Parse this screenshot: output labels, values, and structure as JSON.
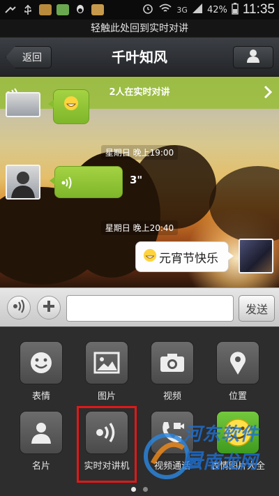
{
  "status_bar": {
    "network": "3G",
    "battery": "42%",
    "time": "11:35"
  },
  "banner": {
    "text": "轻触此处回到实时对讲"
  },
  "title_bar": {
    "back_label": "返回",
    "title": "千叶知风"
  },
  "live_bar": {
    "text": "2人在实时对讲"
  },
  "messages": [
    {
      "timestamp": "星期日 晚上19:00"
    },
    {
      "type": "voice",
      "duration": "3\""
    },
    {
      "timestamp": "星期日 晚上20:40"
    },
    {
      "type": "text",
      "text": "元宵节快乐"
    }
  ],
  "input_bar": {
    "text_value": "",
    "send_label": "发送"
  },
  "plugins": [
    {
      "label": "表情",
      "icon": "smiley-icon"
    },
    {
      "label": "图片",
      "icon": "picture-icon"
    },
    {
      "label": "视频",
      "icon": "camera-icon"
    },
    {
      "label": "位置",
      "icon": "location-pin-icon"
    },
    {
      "label": "名片",
      "icon": "contact-card-icon"
    },
    {
      "label": "实时对讲机",
      "icon": "walkie-talkie-icon"
    },
    {
      "label": "视频通话",
      "icon": "video-call-icon"
    },
    {
      "label": "表情图片大全",
      "icon": "emoji-gallery-icon"
    }
  ],
  "pager": {
    "pages": 2,
    "current": 1
  },
  "watermark": {
    "line1": "河东软件园",
    "line2": "云南龙网"
  },
  "colors": {
    "live_bar": "#96be32",
    "voice_bubble": "#8fc332",
    "highlight": "#e01818",
    "panel": "#2d2d2d"
  }
}
